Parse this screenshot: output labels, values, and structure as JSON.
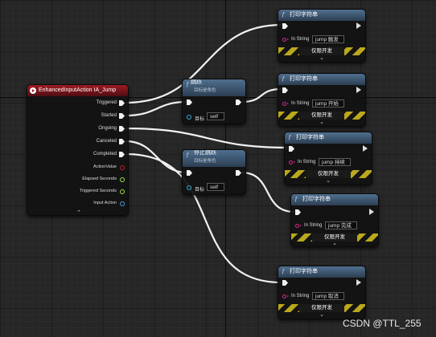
{
  "event_node": {
    "title": "EnhancedInputAction IA_Jump",
    "pins": {
      "triggered": "Triggered",
      "started": "Started",
      "ongoing": "Ongoing",
      "canceled": "Canceled",
      "completed": "Completed",
      "action_value": "ActionValue",
      "elapsed_seconds": "Elapsed Seconds",
      "triggered_seconds": "Triggered Seconds",
      "input_action": "Input Action"
    },
    "expand_glyph": "⌃"
  },
  "jump_node": {
    "title": "跳跃",
    "subtitle": "目标是角色",
    "target_label": "目标",
    "target_value": "self"
  },
  "stop_jump_node": {
    "title": "停止跳跃",
    "subtitle": "目标是角色",
    "target_label": "目标",
    "target_value": "self"
  },
  "print_nodes": [
    {
      "title": "打印字符串",
      "in_label": "In String",
      "in_value": "jump 触发",
      "dev_label": "仅限开发",
      "expand": "⌄"
    },
    {
      "title": "打印字符串",
      "in_label": "In String",
      "in_value": "jump 开始",
      "dev_label": "仅限开发",
      "expand": "⌄"
    },
    {
      "title": "打印字符串",
      "in_label": "In String",
      "in_value": "jump 持续",
      "dev_label": "仅限开发",
      "expand": "⌄"
    },
    {
      "title": "打印字符串",
      "in_label": "In String",
      "in_value": "jump 完成",
      "dev_label": "仅限开发",
      "expand": "⌄"
    },
    {
      "title": "打印字符串",
      "in_label": "In String",
      "in_value": "jump 取消",
      "dev_label": "仅限开发",
      "expand": "⌄"
    }
  ],
  "function_glyph": "ƒ",
  "watermark": "CSDN @TTL_255",
  "colors": {
    "event_header": "#a11a22",
    "function_header": "#2c3e52",
    "exec_wire": "#f2f2f2",
    "string_pin": "#e0268f",
    "object_pin": "#36a8d6",
    "dev_stripe": "#bba81c"
  }
}
